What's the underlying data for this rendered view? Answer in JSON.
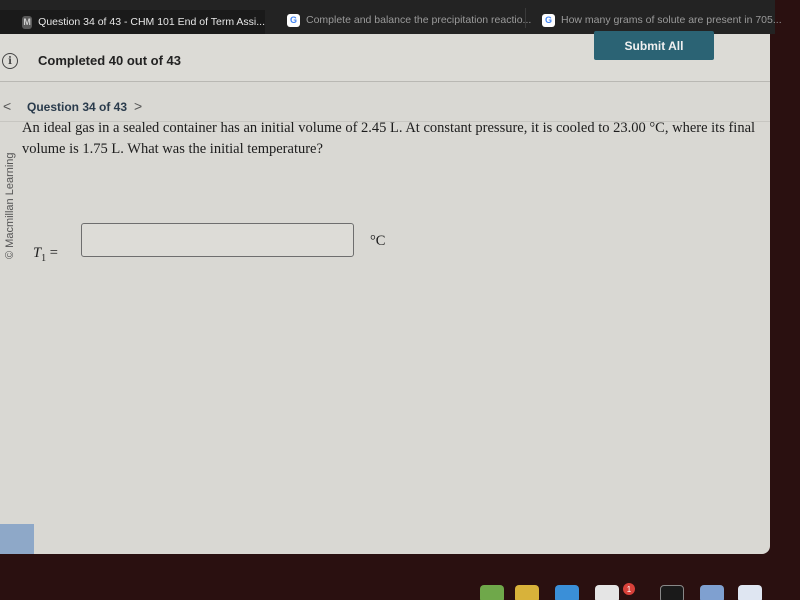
{
  "browser": {
    "tabs": [
      {
        "label": "Question 34 of 43 - CHM 101 End of Term Assi...",
        "favicon": "M",
        "active": true
      },
      {
        "label": "Complete and balance the precipitation reactio...",
        "favicon": "G",
        "active": false
      },
      {
        "label": "How many grams of solute are present in 705...",
        "favicon": "G",
        "active": false
      }
    ]
  },
  "status": {
    "completed_text": "Completed 40 out of 43",
    "info_icon": "i",
    "submit_label": "Submit All"
  },
  "nav": {
    "prev_icon": "<",
    "title": "Question 34 of 43",
    "next_icon": ">"
  },
  "watermark": "© Macmillan Learning",
  "question": {
    "text": "An ideal gas in a sealed container has an initial volume of 2.45 L. At constant pressure, it is cooled to 23.00 °C, where its final volume is 1.75 L. What was the initial temperature?",
    "answer_label_var": "T",
    "answer_label_sub": "1",
    "answer_label_eq": " =",
    "answer_value": "",
    "unit": "°C"
  },
  "dock": {
    "badge_count": "1"
  }
}
